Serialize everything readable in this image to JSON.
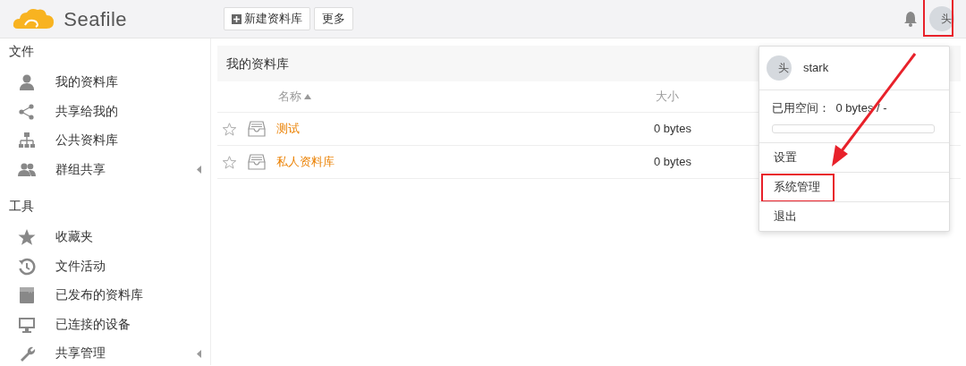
{
  "header": {
    "logo_text": "Seafile",
    "buttons": [
      {
        "label": "新建资料库",
        "kind": "add"
      },
      {
        "label": "更多",
        "kind": "plain"
      }
    ],
    "avatar": {
      "alt": "头",
      "highlighted": true
    }
  },
  "sidebar": {
    "sections": [
      {
        "title": "文件",
        "items": [
          {
            "label": "我的资料库",
            "kind": "user",
            "expandable": false
          },
          {
            "label": "共享给我的",
            "kind": "share",
            "expandable": false
          },
          {
            "label": "公共资料库",
            "kind": "org",
            "expandable": false
          },
          {
            "label": "群组共享",
            "kind": "group",
            "expandable": true
          }
        ]
      },
      {
        "title": "工具",
        "items": [
          {
            "label": "收藏夹",
            "kind": "star",
            "expandable": false
          },
          {
            "label": "文件活动",
            "kind": "history",
            "expandable": false
          },
          {
            "label": "已发布的资料库",
            "kind": "wiki",
            "expandable": false
          },
          {
            "label": "已连接的设备",
            "kind": "monitor",
            "expandable": false
          },
          {
            "label": "共享管理",
            "kind": "wrench",
            "expandable": true
          }
        ]
      }
    ]
  },
  "main": {
    "title": "我的资料库",
    "columns": [
      {
        "label": "名称",
        "sorted": true
      },
      {
        "label": "大小",
        "sorted": false
      }
    ],
    "rows": [
      {
        "name": "测试",
        "size": "0 bytes",
        "starred": false
      },
      {
        "name": "私人资料库",
        "size": "0 bytes",
        "starred": false
      }
    ]
  },
  "user_menu": {
    "avatar_alt": "头",
    "user_name": "stark",
    "quota_label": "已用空间：",
    "quota_value": "0 bytes / -",
    "level": 0,
    "items": [
      {
        "label": "设置",
        "highlighted": false
      },
      {
        "label": "系统管理",
        "highlighted": true
      },
      {
        "label": "退出",
        "highlighted": false
      }
    ]
  }
}
